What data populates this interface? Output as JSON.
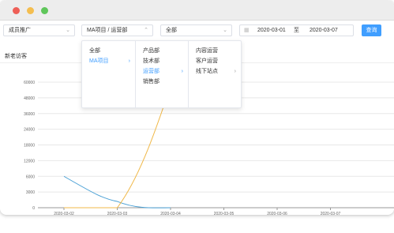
{
  "toolbar": {
    "member_select": "成员推广",
    "project_select": "MA项目 / 运营部",
    "channel_select": "全部",
    "date_start": "2020-03-01",
    "date_sep": "至",
    "date_end": "2020-03-07",
    "query_label": "查询"
  },
  "cascader": {
    "col1": [
      "全部",
      "MA项目"
    ],
    "col2": [
      "产品部",
      "技术部",
      "运营部",
      "销售部"
    ],
    "col3": [
      "内容运营",
      "客户运营",
      "线下站点"
    ]
  },
  "chart_title": "新老访客",
  "chart_data": {
    "type": "line",
    "categories": [
      "2020-03-02",
      "2020-03-03",
      "2020-03-04",
      "2020-03-05",
      "2020-03-06",
      "2020-03-07"
    ],
    "y_ticks": [
      "60000",
      "48000",
      "36000",
      "24000",
      "18000",
      "12000",
      "6000",
      "3000",
      "0"
    ],
    "series": [
      {
        "color": "#4aa0d5",
        "values": [
          6000,
          1200,
          0,
          0,
          0,
          0
        ]
      },
      {
        "color": "#f0b848",
        "values": [
          0,
          0,
          48000,
          60000,
          60000,
          60000
        ]
      }
    ]
  },
  "colors": {
    "accent": "#409eff",
    "gridline": "#e8e8e8"
  }
}
